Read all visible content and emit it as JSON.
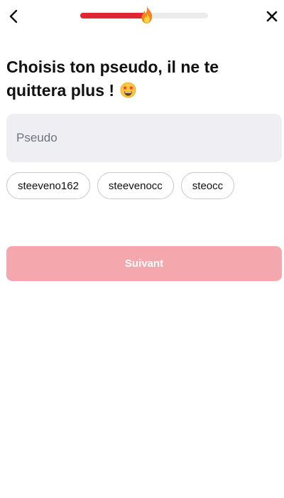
{
  "header": {
    "progress": 0.52,
    "progress_color": "#e0262f",
    "track_color": "#ebebeb",
    "icons": [
      "chevron-left-icon",
      "flame-icon",
      "close-icon"
    ]
  },
  "main": {
    "title": "Choisis ton pseudo, il ne te quittera plus !",
    "title_emoji": "star-struck-emoji",
    "input_placeholder": "Pseudo",
    "input_value": "",
    "suggestions": [
      "steeveno162",
      "steevenocc",
      "steocc"
    ]
  },
  "footer": {
    "next_label": "Suivant",
    "next_button_color": "#f4a7ac"
  }
}
